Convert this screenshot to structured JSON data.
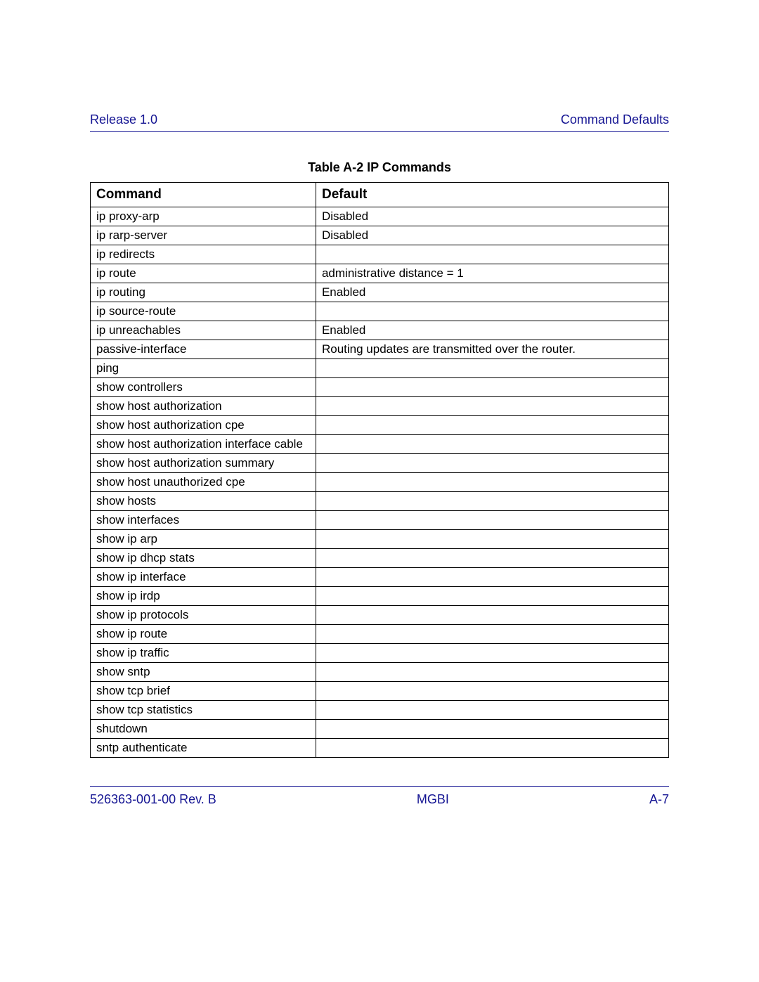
{
  "header": {
    "left": "Release 1.0",
    "right": "Command Defaults"
  },
  "table": {
    "title": "Table A-2   IP Commands",
    "columns": [
      "Command",
      "Default"
    ],
    "rows": [
      {
        "command": "ip proxy-arp",
        "default": "Disabled"
      },
      {
        "command": "ip rarp-server",
        "default": "Disabled"
      },
      {
        "command": "ip redirects",
        "default": ""
      },
      {
        "command": "ip route",
        "default": "administrative distance = 1"
      },
      {
        "command": "ip routing",
        "default": "Enabled"
      },
      {
        "command": "ip source-route",
        "default": ""
      },
      {
        "command": "ip unreachables",
        "default": "Enabled"
      },
      {
        "command": "passive-interface",
        "default": "Routing updates are transmitted over the router."
      },
      {
        "command": "ping",
        "default": ""
      },
      {
        "command": "show controllers",
        "default": ""
      },
      {
        "command": "show host authorization",
        "default": ""
      },
      {
        "command": "show host authorization cpe",
        "default": ""
      },
      {
        "command": "show host authorization interface cable",
        "default": ""
      },
      {
        "command": "show host authorization summary",
        "default": ""
      },
      {
        "command": "show host unauthorized cpe",
        "default": ""
      },
      {
        "command": "show hosts",
        "default": ""
      },
      {
        "command": "show interfaces",
        "default": ""
      },
      {
        "command": "show ip arp",
        "default": ""
      },
      {
        "command": "show ip dhcp stats",
        "default": ""
      },
      {
        "command": "show ip interface",
        "default": ""
      },
      {
        "command": "show ip irdp",
        "default": ""
      },
      {
        "command": "show ip protocols",
        "default": ""
      },
      {
        "command": "show ip route",
        "default": ""
      },
      {
        "command": "show ip traffic",
        "default": ""
      },
      {
        "command": "show sntp",
        "default": ""
      },
      {
        "command": "show tcp brief",
        "default": ""
      },
      {
        "command": "show tcp statistics",
        "default": ""
      },
      {
        "command": "shutdown",
        "default": ""
      },
      {
        "command": "sntp authenticate",
        "default": ""
      }
    ]
  },
  "footer": {
    "left": "526363-001-00 Rev. B",
    "center": "MGBI",
    "right": "A-7"
  }
}
